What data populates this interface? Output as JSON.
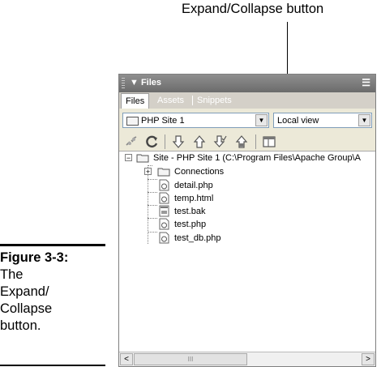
{
  "callout": {
    "text": "Expand/Collapse button"
  },
  "figure": {
    "label": "Figure 3-3:",
    "caption": "The Expand/ Collapse button."
  },
  "panel": {
    "title": "Files",
    "collapse_arrow": "▼",
    "options_icon": "options-menu-icon",
    "tabs": [
      {
        "label": "Files",
        "active": true
      },
      {
        "label": "Assets",
        "active": false
      },
      {
        "label": "Snippets",
        "active": false
      }
    ],
    "site_select": {
      "value": "PHP Site 1"
    },
    "view_select": {
      "value": "Local view"
    },
    "toolbar": [
      "connect-icon",
      "refresh-icon",
      "get-files-icon",
      "put-files-icon",
      "check-out-icon",
      "check-in-icon",
      "expand-collapse-icon"
    ],
    "tree": {
      "root": "Site - PHP Site 1 (C:\\Program Files\\Apache Group\\A",
      "items": [
        {
          "name": "Connections",
          "type": "folder"
        },
        {
          "name": "detail.php",
          "type": "file"
        },
        {
          "name": "temp.html",
          "type": "file"
        },
        {
          "name": "test.bak",
          "type": "file"
        },
        {
          "name": "test.php",
          "type": "file"
        },
        {
          "name": "test_db.php",
          "type": "file"
        }
      ]
    },
    "scrollbar": {
      "left": "<",
      "right": ">",
      "thumb_grip": "III"
    }
  }
}
